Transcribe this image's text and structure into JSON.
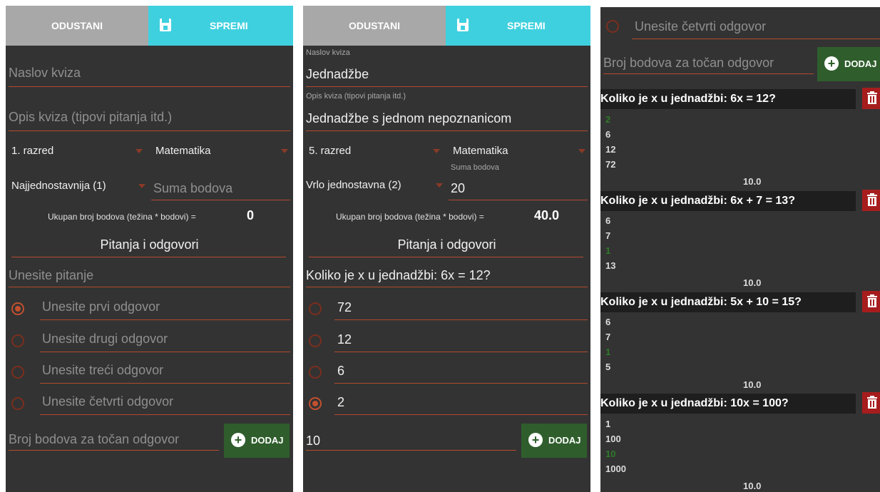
{
  "topbar": {
    "cancel_label": "ODUSTANI",
    "save_label": "SPREMI",
    "save_icon": "save-icon"
  },
  "screen1": {
    "title_placeholder": "Naslov kviza",
    "description_placeholder": "Opis kviza (tipovi pitanja itd.)",
    "grade": "1. razred",
    "subject": "Matematika",
    "difficulty": "Najjednostavnija (1)",
    "points_placeholder": "Suma bodova",
    "total_label": "Ukupan broj bodova (težina * bodovi) =",
    "total_value": "0",
    "section_title": "Pitanja i odgovori",
    "question_placeholder": "Unesite pitanje",
    "answers": [
      {
        "placeholder": "Unesite prvi odgovor",
        "selected": true
      },
      {
        "placeholder": "Unesite drugi odgovor",
        "selected": false
      },
      {
        "placeholder": "Unesite treći odgovor",
        "selected": false
      },
      {
        "placeholder": "Unesite četvrti odgovor",
        "selected": false
      }
    ],
    "correct_points_placeholder": "Broj bodova za točan odgovor",
    "add_label": "DODAJ"
  },
  "screen2": {
    "title_label": "Naslov kviza",
    "title_value": "Jednadžbe",
    "description_label": "Opis kviza (tipovi pitanja itd.)",
    "description_value": "Jednadžbe s jednom nepoznanicom",
    "grade": "5. razred",
    "subject": "Matematika",
    "points_label": "Suma bodova",
    "difficulty": "Vrlo jednostavna (2)",
    "points_value": "20",
    "total_label": "Ukupan broj bodova (težina * bodovi) =",
    "total_value": "40.0",
    "section_title": "Pitanja i odgovori",
    "question_value": "Koliko je x u jednadžbi: 6x = 12?",
    "answers": [
      {
        "value": "72",
        "selected": false
      },
      {
        "value": "12",
        "selected": false
      },
      {
        "value": "6",
        "selected": false
      },
      {
        "value": "2",
        "selected": true
      }
    ],
    "correct_points_value": "10",
    "add_label": "DODAJ"
  },
  "screen3": {
    "fourth_answer_placeholder": "Unesite četvrti odgovor",
    "correct_points_placeholder": "Broj bodova za točan odgovor",
    "add_label": "DODAJ",
    "questions": [
      {
        "text": "Koliko je x u jednadžbi: 6x = 12?",
        "answers": [
          "2",
          "6",
          "12",
          "72"
        ],
        "correct_index": 0,
        "points": "10.0"
      },
      {
        "text": "Koliko je x u jednadžbi: 6x + 7 = 13?",
        "answers": [
          "6",
          "7",
          "1",
          "13"
        ],
        "correct_index": 2,
        "points": "10.0"
      },
      {
        "text": "Koliko je x u jednadžbi: 5x + 10 = 15?",
        "answers": [
          "6",
          "7",
          "1",
          "5"
        ],
        "correct_index": 2,
        "points": "10.0"
      },
      {
        "text": "Koliko je x u jednadžbi: 10x = 100?",
        "answers": [
          "1",
          "100",
          "10",
          "1000"
        ],
        "correct_index": 2,
        "points": "10.0"
      }
    ]
  },
  "colors": {
    "background": "#333333",
    "accent_line": "#b34a2e",
    "save": "#3fd0df",
    "cancel": "#a8a8a8",
    "add": "#2f5e2c",
    "delete": "#a71d1d"
  }
}
